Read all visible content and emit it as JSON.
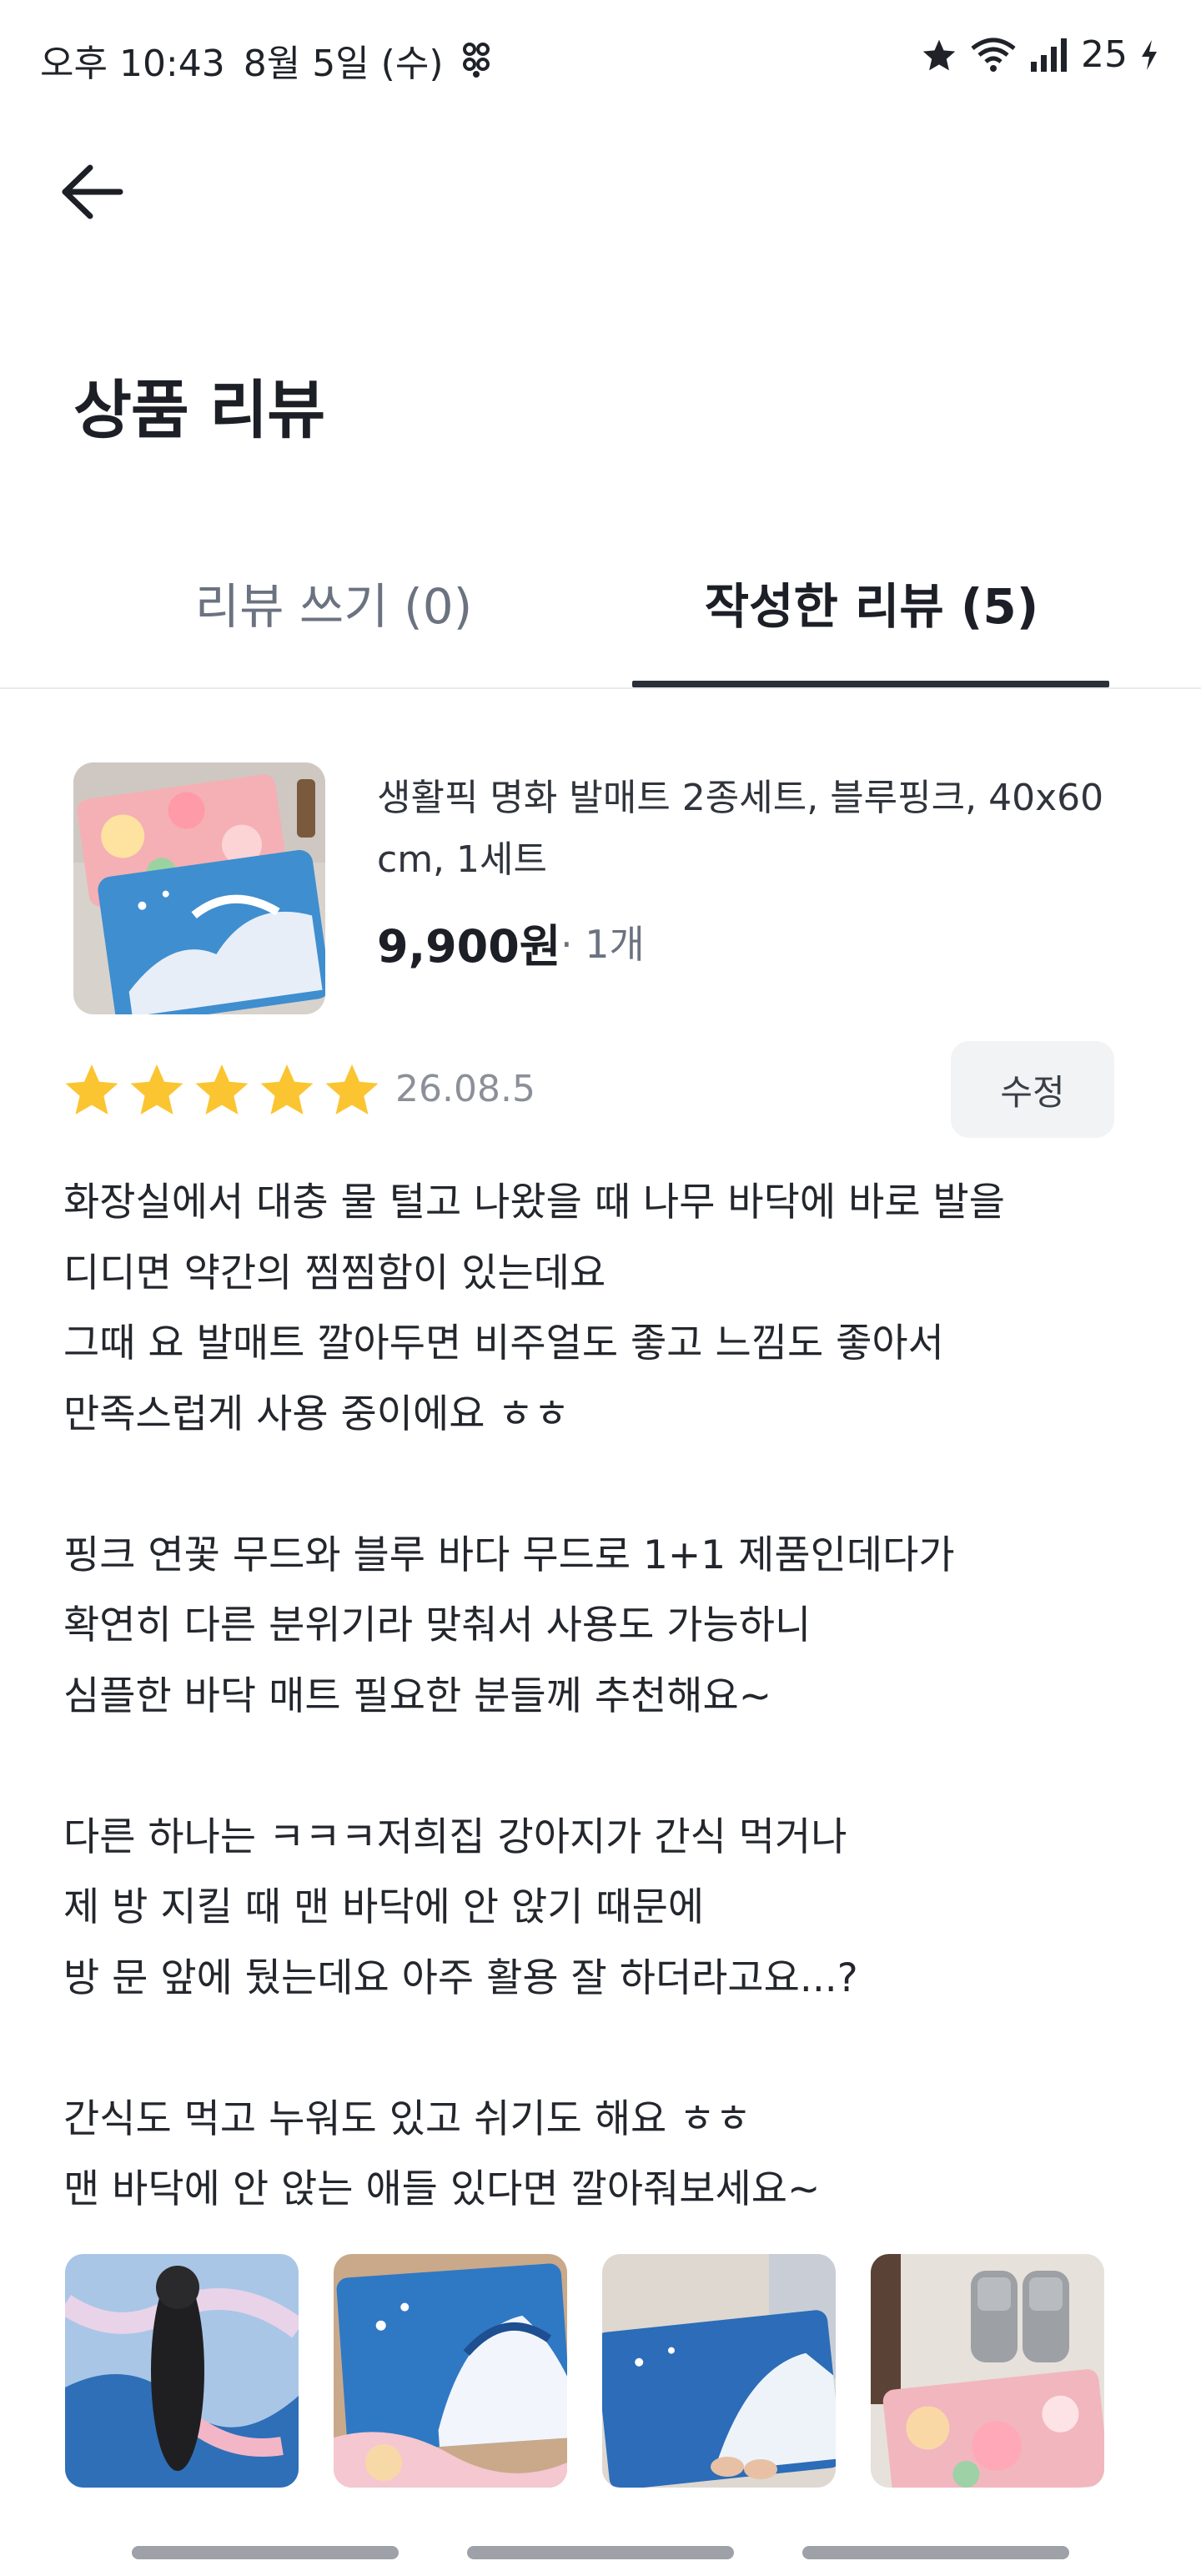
{
  "status_bar": {
    "time": "오후 10:43",
    "date": "8월 5일 (수)",
    "battery": "25"
  },
  "header": {
    "title": "상품 리뷰"
  },
  "tabs": [
    {
      "label": "리뷰 쓰기 (0)",
      "active": false
    },
    {
      "label": "작성한 리뷰 (5)",
      "active": true
    }
  ],
  "product": {
    "name": "생활픽 명화 발매트 2종세트, 블루핑크, 40x60 cm, 1세트",
    "name_line1": "생활픽 명화 발매트 2종세트, 블루핑크, 40x60",
    "name_line2": "cm, 1세트",
    "price": "9,900원",
    "qty": "· 1개"
  },
  "review": {
    "rating": 5,
    "date": "26.08.5",
    "edit_label": "수정",
    "lines": [
      "화장실에서 대충 물 털고 나왔을 때 나무 바닥에 바로 발을",
      "디디면 약간의 찜찜함이 있는데요",
      "그때 요 발매트 깔아두면 비주얼도 좋고 느낌도 좋아서",
      "만족스럽게 사용 중이에요 ㅎㅎ",
      "",
      "핑크 연꽃 무드와 블루 바다 무드로 1+1 제품인데다가",
      "확연히 다른 분위기라 맞춰서 사용도 가능하니",
      "심플한 바닥 매트 필요한 분들께 추천해요~",
      "",
      "다른 하나는 ㅋㅋㅋ저희집 강아지가 간식 먹거나",
      "제 방 지킬 때 맨 바닥에 안 앉기 때문에",
      "방 문 앞에 뒀는데요 아주 활용 잘 하더라고요...?",
      "",
      "간식도 먹고 누워도 있고 쉬기도 해요 ㅎㅎ",
      "맨 바닥에 안 앉는 애들 있다면 깔아줘보세요~"
    ]
  },
  "colors": {
    "star": "#fbc531",
    "active_tab": "#1c1f26",
    "inactive_tab": "#6b7280",
    "indicator": "#2b2f3a"
  }
}
